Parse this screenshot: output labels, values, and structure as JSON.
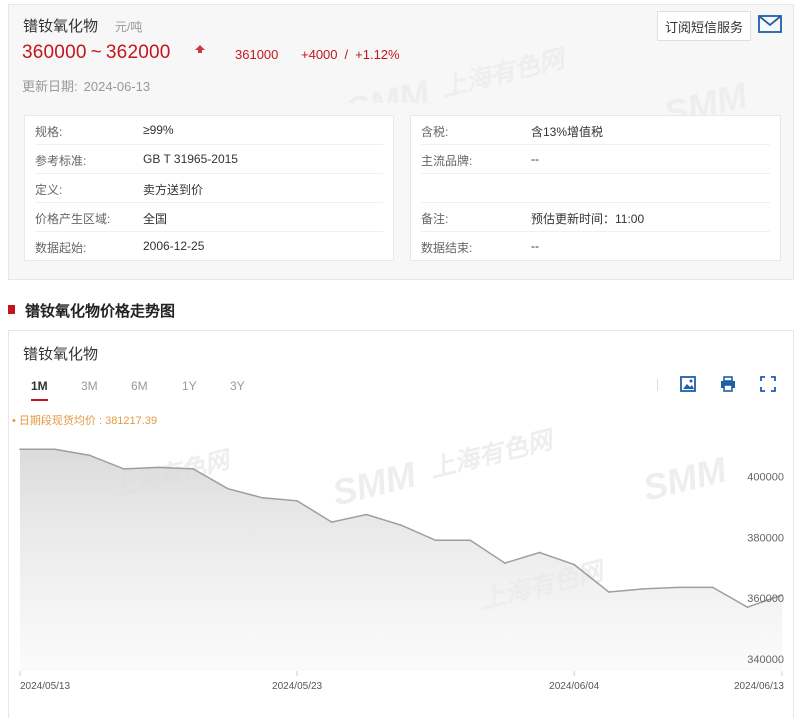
{
  "product": {
    "title": "镨钕氧化物",
    "unit": "元/吨",
    "price_low": "360000",
    "tilde": "~",
    "price_high": "362000",
    "average": "361000",
    "change_abs": "+4000",
    "change_sep": "/",
    "change_pct": "+1.12%",
    "update_label": "更新日期:",
    "update_date": "2024-06-13",
    "subscribe_label": "订阅短信服务"
  },
  "specs_left": [
    {
      "key": "规格:",
      "value": "≥99%"
    },
    {
      "key": "参考标准:",
      "value": "GB T 31965-2015"
    },
    {
      "key": "定义:",
      "value": "卖方送到价"
    },
    {
      "key": "价格产生区域:",
      "value": "全国"
    },
    {
      "key": "数据起始:",
      "value": "2006-12-25"
    }
  ],
  "specs_right": [
    {
      "key": "含税:",
      "value": "含13%增值税"
    },
    {
      "key": "主流品牌:",
      "value": "--"
    },
    {
      "key": "",
      "value": ""
    },
    {
      "key": "备注:",
      "value": "预估更新时间：11:00"
    },
    {
      "key": "数据结束:",
      "value": "--"
    }
  ],
  "section_title": "镨钕氧化物价格走势图",
  "chart_card": {
    "name": "镨钕氧化物",
    "ranges": [
      "1M",
      "3M",
      "6M",
      "1Y",
      "3Y"
    ],
    "active_range": "1M",
    "average_label": "• 日期段现货均价 : 381217.39"
  },
  "watermark": {
    "logo": "SMM",
    "text": "上海有色网"
  },
  "colors": {
    "accent": "#c3161c",
    "line": "#9e9e9e",
    "average_label": "#e39a45"
  },
  "icons": [
    "mail-icon",
    "image-icon",
    "print-icon",
    "fullscreen-icon",
    "price-up-icon"
  ],
  "chart_data": {
    "type": "area",
    "title": "镨钕氧化物",
    "x": [
      "2024-05-13",
      "2024-05-14",
      "2024-05-15",
      "2024-05-16",
      "2024-05-17",
      "2024-05-20",
      "2024-05-21",
      "2024-05-22",
      "2024-05-23",
      "2024-05-24",
      "2024-05-27",
      "2024-05-28",
      "2024-05-29",
      "2024-05-30",
      "2024-05-31",
      "2024-06-03",
      "2024-06-04",
      "2024-06-05",
      "2024-06-06",
      "2024-06-07",
      "2024-06-11",
      "2024-06-12",
      "2024-06-13"
    ],
    "series": [
      {
        "values": [
          409000,
          409000,
          407000,
          402500,
          403000,
          402500,
          396000,
          393000,
          392000,
          385000,
          387500,
          384000,
          379000,
          379000,
          371500,
          375000,
          371000,
          362000,
          363000,
          363500,
          363500,
          357000,
          361000
        ]
      }
    ],
    "x_tick_labels": [
      "2024/05/13",
      "2024/05/23",
      "2024/06/04",
      "2024/06/13"
    ],
    "y_ticks": [
      340000,
      360000,
      380000,
      400000
    ],
    "ylim": [
      336000,
      413000
    ],
    "average": 381217.39,
    "grid": false,
    "xlabel": "",
    "ylabel": ""
  }
}
